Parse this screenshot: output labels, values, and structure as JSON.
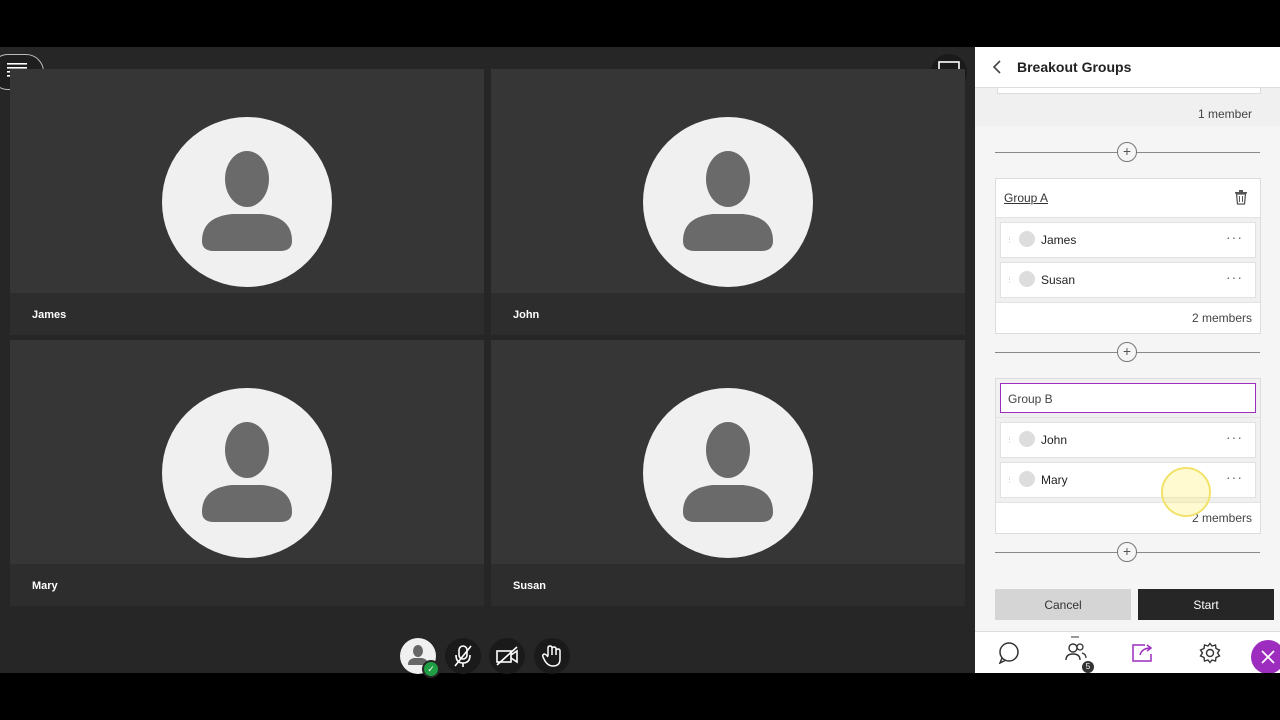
{
  "participants": [
    {
      "name": "James"
    },
    {
      "name": "John"
    },
    {
      "name": "Mary"
    },
    {
      "name": "Susan"
    }
  ],
  "panel": {
    "title": "Breakout Groups",
    "top_group_count": "1 member",
    "groups": [
      {
        "label": "Group A",
        "members": [
          "James",
          "Susan"
        ],
        "count": "2 members"
      },
      {
        "label": "Group B",
        "members": [
          "John",
          "Mary"
        ],
        "count": "2 members"
      }
    ],
    "cancel_label": "Cancel",
    "start_label": "Start",
    "attendee_badge": "5"
  },
  "colors": {
    "accent": "#9c2dbf",
    "stage_bg": "#262626",
    "tile_bg": "#363636",
    "status_green": "#1f9e44"
  },
  "icons": [
    "hamburger-icon",
    "layout-icon",
    "avatar-icon",
    "mic-off-icon",
    "camera-off-icon",
    "hand-raise-icon",
    "chevron-left-icon",
    "trash-icon",
    "plus-icon",
    "more-icon",
    "chat-icon",
    "attendees-icon",
    "share-icon",
    "gear-icon",
    "close-icon"
  ]
}
